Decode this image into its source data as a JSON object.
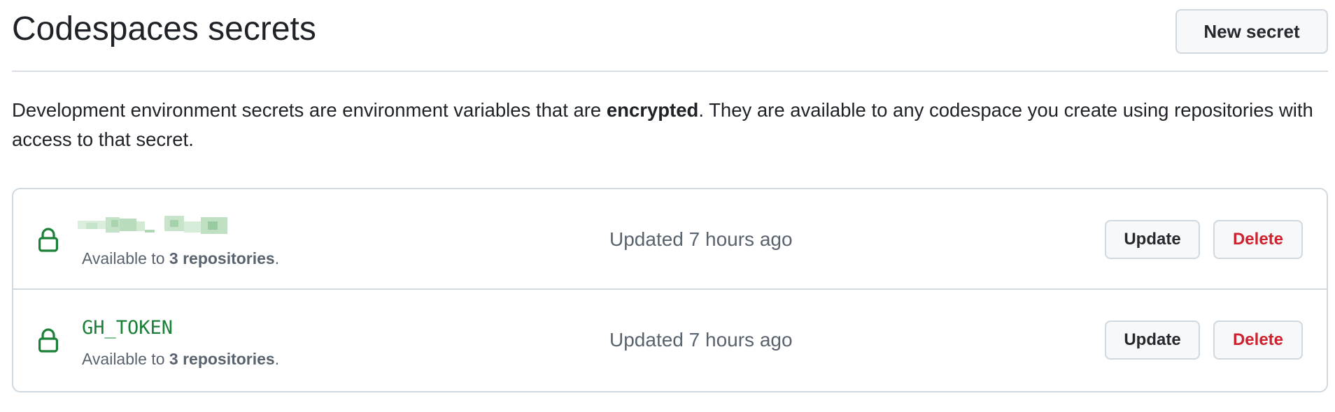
{
  "header": {
    "title": "Codespaces secrets",
    "new_secret_label": "New secret"
  },
  "description": {
    "text_before": "Development environment secrets are environment variables that are ",
    "text_bold": "encrypted",
    "text_after": ". They are available to any codespace you create using repositories with access to that secret."
  },
  "secrets": [
    {
      "name": "",
      "name_obscured": true,
      "availability_prefix": "Available to ",
      "availability_count": "3 repositories",
      "availability_suffix": ".",
      "updated": "Updated 7 hours ago",
      "update_label": "Update",
      "delete_label": "Delete"
    },
    {
      "name": "GH_TOKEN",
      "name_obscured": false,
      "availability_prefix": "Available to ",
      "availability_count": "3 repositories",
      "availability_suffix": ".",
      "updated": "Updated 7 hours ago",
      "update_label": "Update",
      "delete_label": "Delete"
    }
  ],
  "colors": {
    "secret_name": "#1a7f37",
    "lock_icon": "#1a7f37",
    "delete": "#cf222e",
    "muted_text": "#59636e",
    "border": "#d1d9e0"
  },
  "icons": {
    "lock": "lock-icon"
  }
}
